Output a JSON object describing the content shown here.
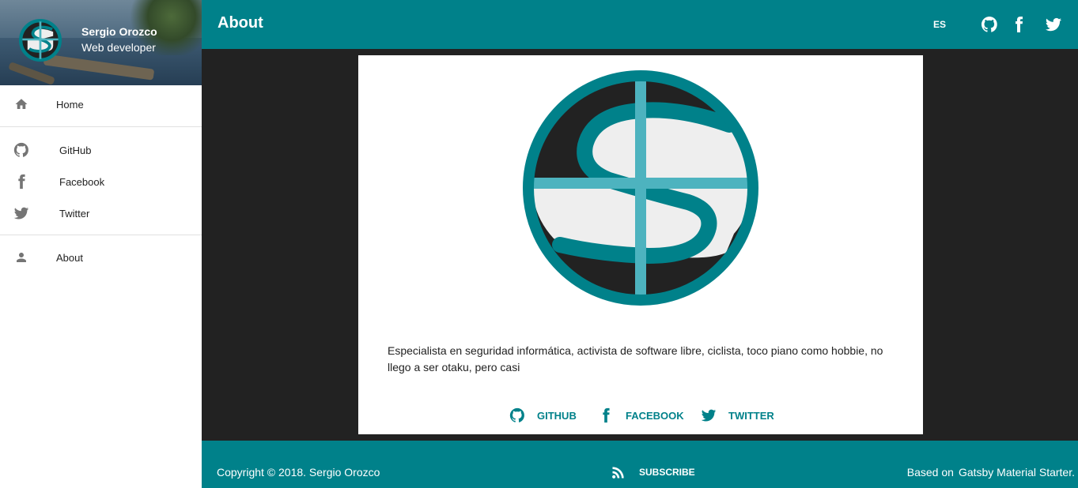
{
  "colors": {
    "primary": "#00818a",
    "background": "#222222",
    "card": "#ffffff",
    "logo_light": "#4db3bf",
    "logo_dark": "#222222"
  },
  "sidebar": {
    "profile": {
      "name": "Sergio Orozco",
      "role": "Web developer",
      "avatar_icon": "s-logo-icon"
    },
    "items": [
      {
        "label": "Home",
        "icon": "home-icon"
      },
      {
        "label": "GitHub",
        "icon": "github-icon"
      },
      {
        "label": "Facebook",
        "icon": "facebook-icon"
      },
      {
        "label": "Twitter",
        "icon": "twitter-icon"
      },
      {
        "label": "About",
        "icon": "person-icon"
      }
    ]
  },
  "appbar": {
    "title": "About",
    "language": "ES",
    "social_icons": [
      "github-icon",
      "facebook-icon",
      "twitter-icon"
    ]
  },
  "about": {
    "logo_icon": "s-logo-icon",
    "bio": "Especialista en seguridad informática, activista de software libre, ciclista, toco piano como hobbie, no llego a ser otaku, pero casi",
    "links": [
      {
        "label": "GITHUB",
        "icon": "github-icon"
      },
      {
        "label": "FACEBOOK",
        "icon": "facebook-icon"
      },
      {
        "label": "TWITTER",
        "icon": "twitter-icon"
      }
    ]
  },
  "footer": {
    "copyright": "Copyright © 2018. Sergio Orozco",
    "subscribe": "SUBSCRIBE",
    "subscribe_icon": "rss-icon",
    "based_on_prefix": "Based on",
    "based_on_link": "Gatsby Material Starter."
  }
}
